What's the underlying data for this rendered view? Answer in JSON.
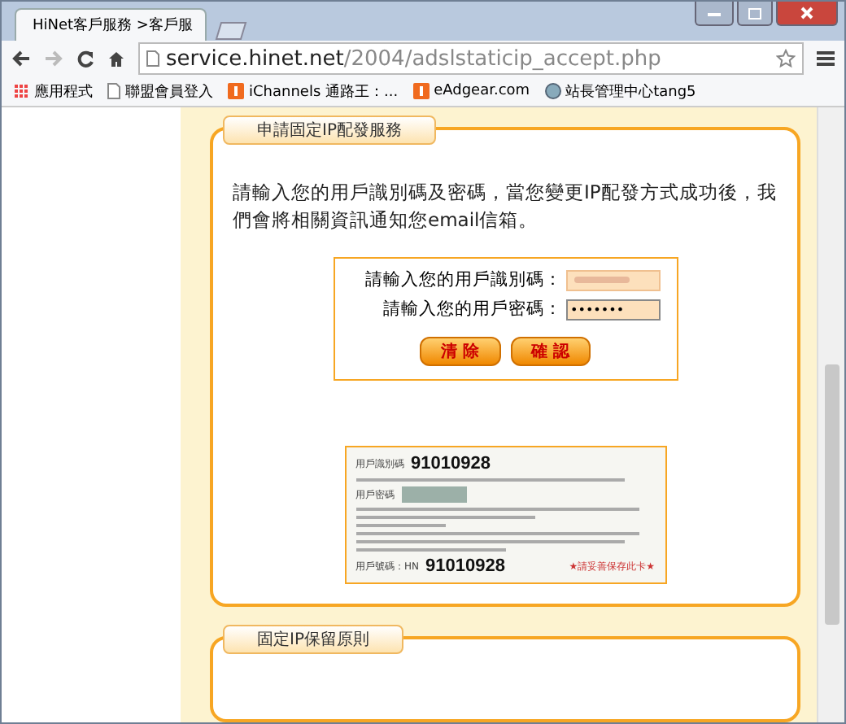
{
  "browser": {
    "tab_title": "HiNet客戶服務 >客戶服",
    "address": {
      "host": "service.hinet.net",
      "path": "/2004/adslstaticip_accept.php"
    },
    "bookmarks": [
      {
        "label": "應用程式",
        "kind": "apps"
      },
      {
        "label": "聯盟會員登入",
        "kind": "page"
      },
      {
        "label": "iChannels 通路王：...",
        "kind": "orange"
      },
      {
        "label": "eAdgear.com",
        "kind": "orange"
      },
      {
        "label": "站長管理中心tang5",
        "kind": "globe"
      }
    ]
  },
  "sections": [
    {
      "title": "申請固定IP配發服務",
      "intro": "請輸入您的用戶識別碼及密碼，當您變更IP配發方式成功後，我們會將相關資訊通知您email信箱。",
      "fields": [
        {
          "label": "請輸入您的用戶識別碼：",
          "kind": "blurred"
        },
        {
          "label": "請輸入您的用戶密碼：",
          "kind": "password",
          "value": "•••••••"
        }
      ],
      "buttons": [
        "清 除",
        "確 認"
      ],
      "card": {
        "id_label": "用戶識別碼",
        "id_value": "91010928",
        "password_label": "用戶密碼",
        "hn_label": "用戶號碼：HN",
        "hn_value": "91010928",
        "footer": "★請妥善保存此卡★"
      }
    },
    {
      "title": "固定IP保留原則"
    }
  ]
}
